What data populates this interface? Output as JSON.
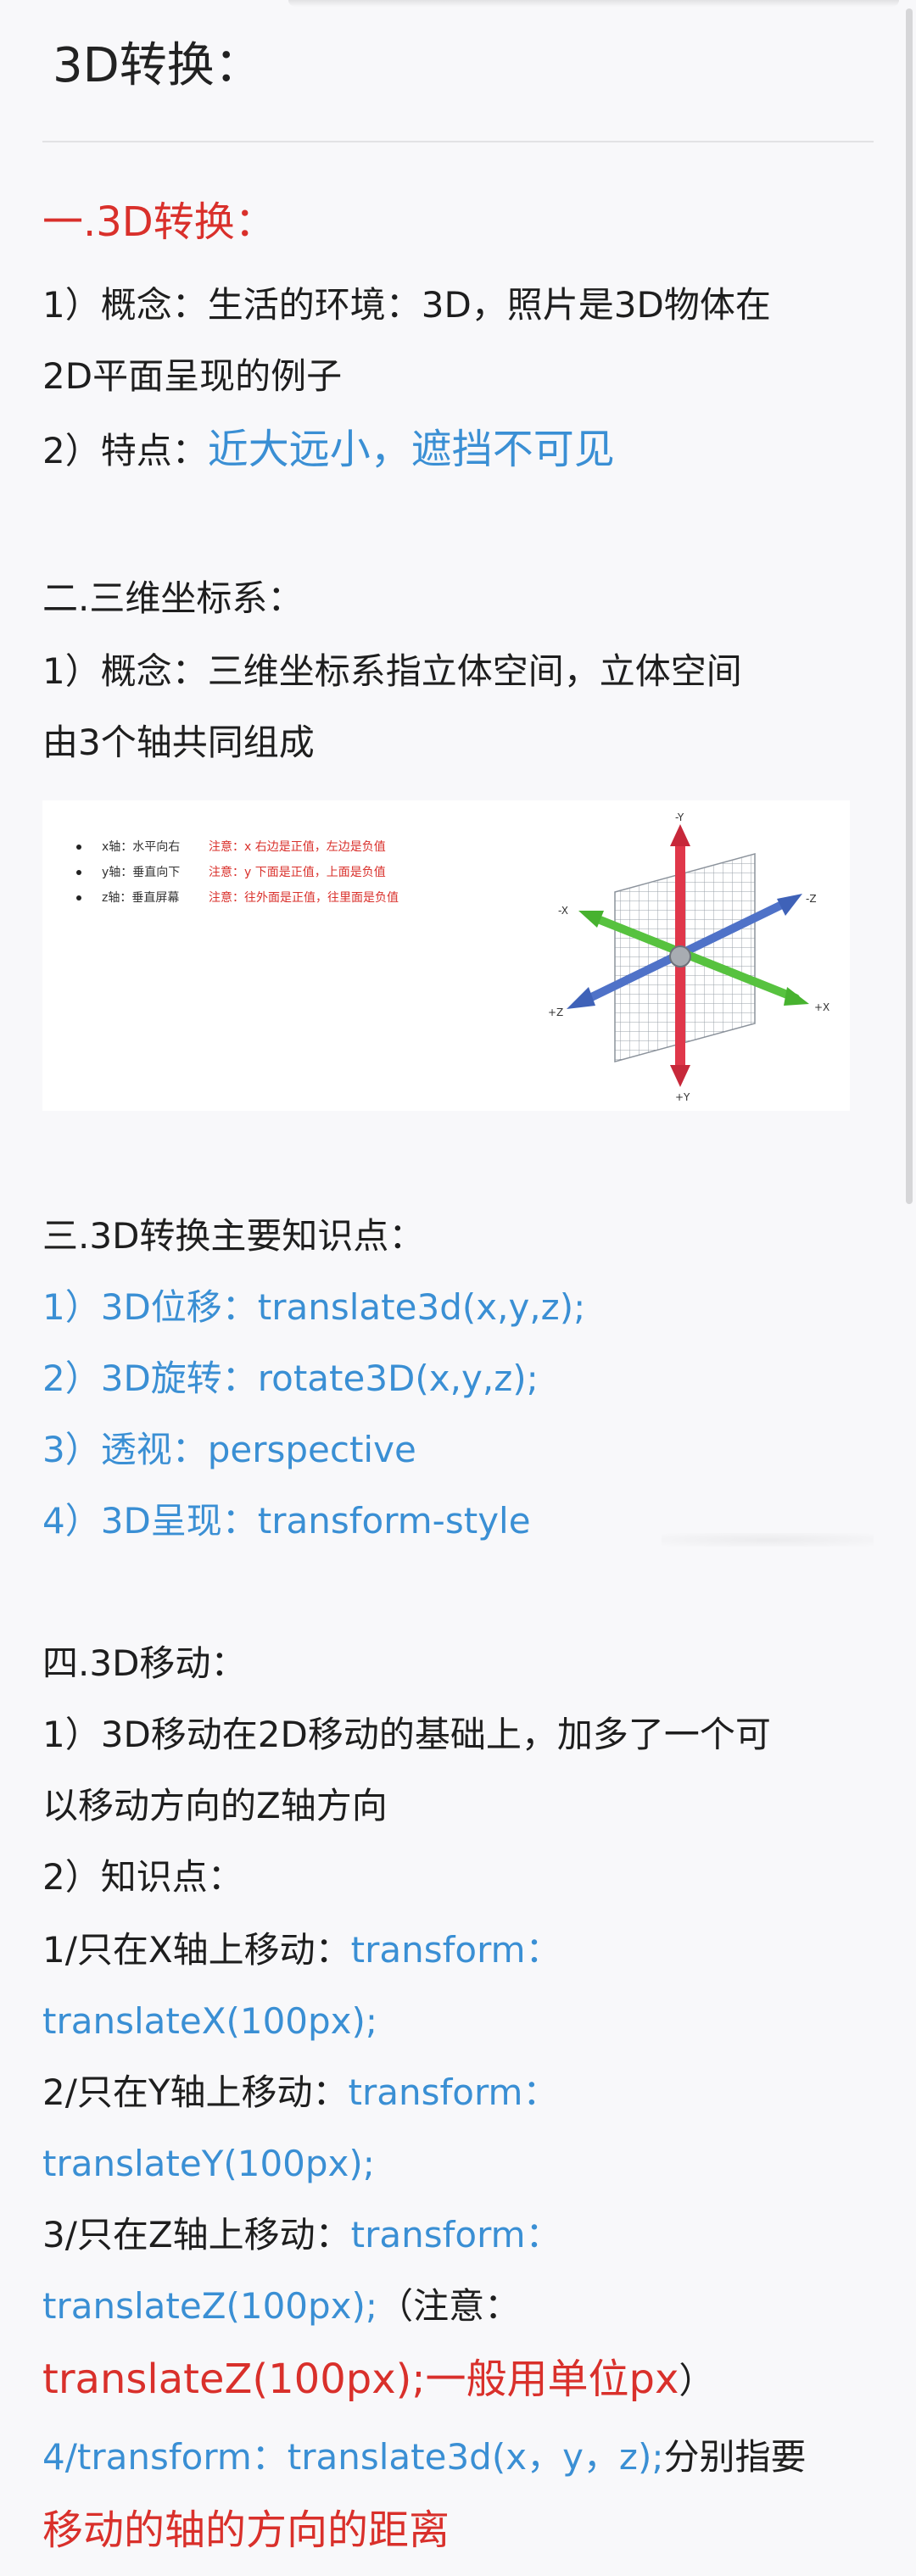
{
  "title": "3D转换：",
  "section1": {
    "heading": "一.3D转换：",
    "concept_line1": "1）概念：生活的环境：3D，照片是3D物体在",
    "concept_line2": "2D平面呈现的例子",
    "feature_label": "2）特点：",
    "feature_value": "近大远小，遮挡不可见"
  },
  "section2": {
    "heading": "二.三维坐标系：",
    "concept_line1": "1）概念：三维坐标系指立体空间，立体空间",
    "concept_line2": "由3个轴共同组成",
    "figure": {
      "legend": [
        {
          "axis": "x轴：水平向右",
          "note": "注意：x 右边是正值，左边是负值"
        },
        {
          "axis": "y轴：垂直向下",
          "note": "注意：y 下面是正值，上面是负值"
        },
        {
          "axis": "z轴：垂直屏幕",
          "note": "注意：往外面是正值，往里面是负值"
        }
      ],
      "axis_labels": {
        "neg_y": "-Y",
        "pos_y": "+Y",
        "neg_x": "-X",
        "pos_x": "+X",
        "neg_z": "-Z",
        "pos_z": "+Z"
      },
      "colors": {
        "y_axis": "#e0374a",
        "x_axis": "#57c23f",
        "z_axis": "#4f72c8",
        "plane": "#9aa0a8"
      }
    }
  },
  "section3": {
    "heading": "三.3D转换主要知识点：",
    "items": [
      "1）3D位移：translate3d(x,y,z);",
      "2）3D旋转：rotate3D(x,y,z);",
      "3）透视：perspective",
      "4）3D呈现：transform-style"
    ]
  },
  "section4": {
    "heading": "四.3D移动：",
    "intro_line1": "1）3D移动在2D移动的基础上，加多了一个可",
    "intro_line2": "以移动方向的Z轴方向",
    "knowledge": "2）知识点：",
    "x_label": "1/只在X轴上移动：",
    "x_code1": "transform：",
    "x_code2": "translateX(100px);",
    "y_label": "2/只在Y轴上移动：",
    "y_code1": "transform：",
    "y_code2": "translateY(100px);",
    "z_label": "3/只在Z轴上移动：",
    "z_code1": "transform：",
    "z_code2": "translateZ(100px);",
    "z_note_open": "（注意：",
    "z_note_red": "translateZ(100px);一般用单位px",
    "z_note_close": "）",
    "item4_blue": "4/transform：translate3d(x，y，z);",
    "item4_black": "分别指要",
    "item4_red": "移动的轴的方向的距离"
  }
}
